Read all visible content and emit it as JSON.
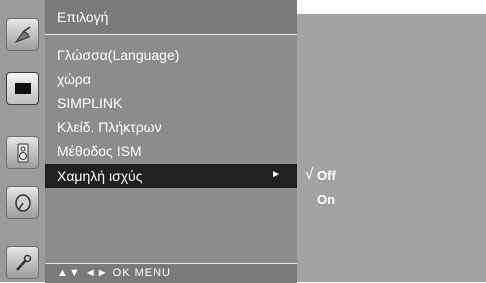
{
  "menu": {
    "title": "Επιλογή",
    "items": [
      {
        "label": "Γλώσσα(Language)"
      },
      {
        "label": "χώρα"
      },
      {
        "label": "SIMPLINK"
      },
      {
        "label": "Κλείδ. Πλήκτρων"
      },
      {
        "label": "Μέθοδος ISM"
      },
      {
        "label": "Χαμηλή ισχύς",
        "selected": true,
        "arrow": "►"
      }
    ]
  },
  "submenu": {
    "check": "√",
    "options": [
      {
        "label": "Off",
        "checked": true
      },
      {
        "label": "On",
        "checked": false
      }
    ]
  },
  "bottom_bar": {
    "hint": "▲▼ ◄► OK MENU"
  },
  "sidebar": {
    "icons": [
      "satellite-dish-icon",
      "screen-icon",
      "speaker-icon",
      "clock-icon",
      "wrench-icon"
    ]
  }
}
